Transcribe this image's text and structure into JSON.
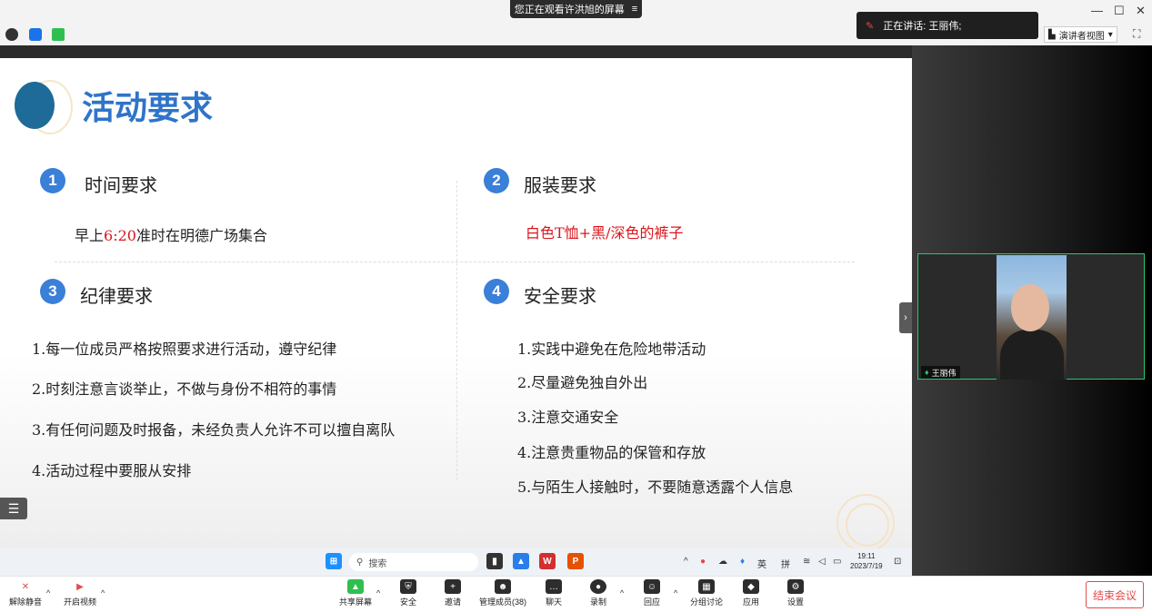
{
  "share_banner": {
    "text": "您正在观看许洪旭的屏幕"
  },
  "speaking": {
    "text": "正在讲话: 王丽伟;"
  },
  "toolbar": {
    "presenter_view": "演讲者视图"
  },
  "slide": {
    "title": "活动要求",
    "sections": [
      {
        "num": "1",
        "title": "时间要求"
      },
      {
        "num": "2",
        "title": "服装要求"
      },
      {
        "num": "3",
        "title": "纪律要求"
      },
      {
        "num": "4",
        "title": "安全要求"
      }
    ],
    "time_prefix": "早上",
    "time_value_a": "6",
    "time_colon": ":",
    "time_value_b": "20",
    "time_suffix": "准时在明德广场集合",
    "dress_text": "白色T恤+黑/深色的裤子",
    "discipline": [
      "1.每一位成员严格按照要求进行活动，遵守纪律",
      "2.时刻注意言谈举止，不做与身份不相符的事情",
      "3.有任何问题及时报备，未经负责人允许不可以擅自离队",
      "4.活动过程中要服从安排"
    ],
    "safety": [
      "1.实践中避免在危险地带活动",
      "2.尽量避免独自外出",
      "3.注意交通安全",
      "4.注意贵重物品的保管和存放",
      "5.与陌生人接触时，不要随意透露个人信息"
    ]
  },
  "taskbar": {
    "search_placeholder": "搜索",
    "ime_lang": "英",
    "ime_mode": "拼",
    "time": "19:11",
    "date": "2023/7/19"
  },
  "video": {
    "name": "王丽伟"
  },
  "bottom_bar": {
    "unmute": "解除静音",
    "start_video": "开启视频",
    "share": "共享屏幕",
    "security": "安全",
    "invite": "邀请",
    "members": "管理成员(38)",
    "chat": "聊天",
    "record": "录制",
    "reactions": "回应",
    "breakout": "分组讨论",
    "apps": "应用",
    "settings": "设置",
    "end": "结束会议"
  },
  "colors": {
    "accent": "#3a7fd8",
    "title": "#2e74c9",
    "red": "#d9161c",
    "end": "#e34a4a",
    "active_border": "#28c76f"
  }
}
